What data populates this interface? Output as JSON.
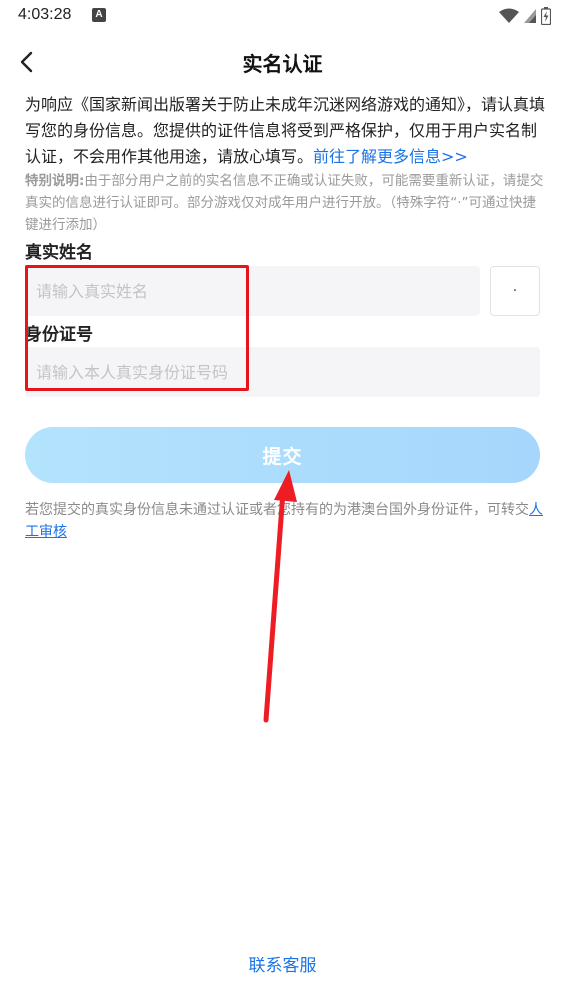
{
  "status_bar": {
    "time": "4:03:28",
    "notification_letter": "A",
    "icons": [
      "wifi-icon",
      "signal-icon",
      "battery-icon"
    ]
  },
  "header": {
    "title": "实名认证",
    "back_icon": "chevron-left-icon"
  },
  "notice": {
    "text": "为响应《国家新闻出版署关于防止未成年沉迷网络游戏的通知》，请认真填写您的身份信息。您提供的证件信息将受到严格保护，仅用于用户实名制认证，不会用作其他用途，请放心填写。",
    "link": "前往了解更多信息>>"
  },
  "special_notice": {
    "label": "特别说明:",
    "text": "由于部分用户之前的实名信息不正确或认证失败，可能需要重新认证，请提交真实的信息进行认证即可。部分游戏仅对成年用户进行开放。（特殊字符“·”可通过快捷键进行添加）"
  },
  "form": {
    "name_label": "真实姓名",
    "name_value": "",
    "name_placeholder": "请输入真实姓名",
    "dot_button": "·",
    "id_label": "身份证号",
    "id_value": "",
    "id_placeholder": "请输入本人真实身份证号码",
    "submit_label": "提交"
  },
  "bottom_note": {
    "text": "若您提交的真实身份信息未通过认证或者您持有的为港澳台国外身份证件，可转交",
    "link": "人工审核"
  },
  "footer": {
    "contact": "联系客服"
  },
  "colors": {
    "link": "#1a73e8",
    "submit_gradient_start": "#b3e3fd",
    "submit_gradient_end": "#a6d6fb",
    "annotation_red": "#e8141b",
    "input_bg": "#f5f5f7"
  }
}
